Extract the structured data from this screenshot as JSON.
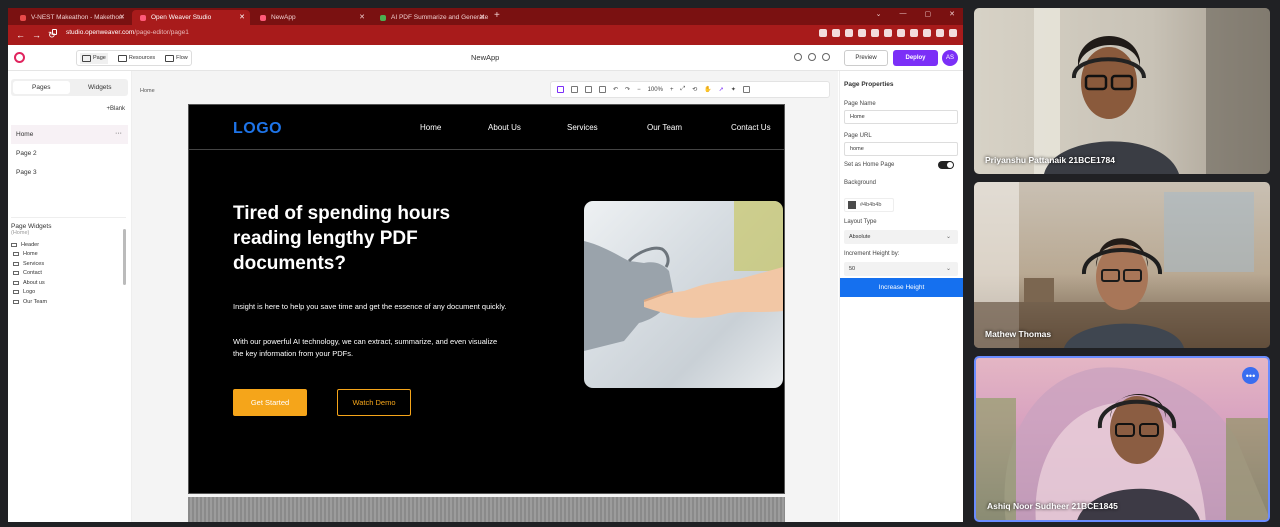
{
  "browser": {
    "tabs": [
      {
        "label": "V-NEST Makeathon - Makethon",
        "active": false
      },
      {
        "label": "Open Weaver Studio",
        "active": true
      },
      {
        "label": "NewApp",
        "active": false
      },
      {
        "label": "AI PDF Summarize and Generate",
        "active": false
      }
    ],
    "url_host": "studio.openweaver.com",
    "url_path": "/page-editor/page1"
  },
  "app": {
    "modes": [
      "Page",
      "Resources",
      "Flow"
    ],
    "title": "NewApp",
    "preview_label": "Preview",
    "deploy_label": "Deploy",
    "avatar_initials": "AS"
  },
  "left_panel": {
    "tabs": [
      "Pages",
      "Widgets"
    ],
    "blank_label": "Blank",
    "pages": [
      "Home",
      "Page 2",
      "Page 3"
    ],
    "widgets_title": "Page Widgets",
    "widgets_sub": "(Home)",
    "widgets": [
      "Header",
      "Home",
      "Services",
      "Contact",
      "About us",
      "Logo",
      "Our Team"
    ]
  },
  "canvas": {
    "breadcrumb": "Home",
    "zoom": "100%"
  },
  "site": {
    "logo": "LOGO",
    "nav": [
      "Home",
      "About Us",
      "Services",
      "Our Team",
      "Contact Us"
    ],
    "headline": "Tired of spending hours reading lengthy PDF documents?",
    "para1": "Insight is here to help you save time and get the essence of any document quickly.",
    "para2": "With our powerful AI technology, we can extract, summarize, and even visualize the key information from your PDFs.",
    "cta_primary": "Get Started",
    "cta_secondary": "Watch Demo"
  },
  "properties": {
    "title": "Page Properties",
    "page_name_label": "Page Name",
    "page_name": "Home",
    "page_url_label": "Page URL",
    "page_url": "home",
    "home_toggle_label": "Set as Home Page",
    "background_label": "Background",
    "background_value": "#4b4b4b",
    "layout_label": "Layout Type",
    "layout_value": "Absolute",
    "increment_label": "Increment Height by:",
    "increment_value": "50",
    "increase_button": "Increase Height"
  },
  "participants": [
    "Priyanshu Pattanaik 21BCE1784",
    "Mathew Thomas",
    "Ashiq Noor Sudheer 21BCE1845"
  ],
  "colors": {
    "browser_tab_bar": "#7a1111",
    "accent_purple": "#7b2ff7",
    "site_logo_blue": "#1e74e8",
    "cta_orange": "#f5a51a",
    "increase_blue": "#1570ef"
  }
}
